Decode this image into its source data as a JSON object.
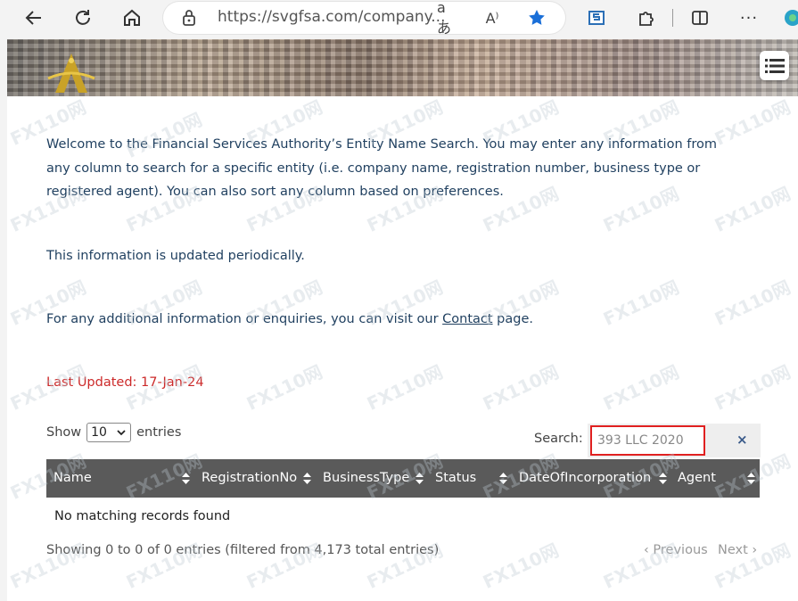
{
  "browser": {
    "url": "https://svgfsa.com/company...",
    "icons": [
      "back-icon",
      "refresh-icon",
      "home-icon",
      "lock-icon",
      "read-aloud-icon",
      "text-size-icon",
      "favorite-star-icon",
      "extension-icon",
      "puzzle-icon",
      "split-screen-icon",
      "more-icon"
    ],
    "read_aloud_glyph": "aあ",
    "immersive_glyph": "A⁾",
    "more_glyph": "···"
  },
  "page": {
    "intro": "Welcome to the Financial Services Authority’s Entity Name Search. You may enter any information from any column to search for a specific entity (i.e. company name, registration number, business type or registered agent). You can also sort any column based on preferences.",
    "periodic": "This information is updated periodically.",
    "enquiries_before": "For any additional information or enquiries, you can visit our ",
    "contact_link": "Contact",
    "enquiries_after": " page.",
    "last_updated": "Last Updated:  17-Jan-24"
  },
  "table": {
    "show_label": "Show",
    "entries_value": "10",
    "entries_label": "entries",
    "search_label": "Search:",
    "search_value": "393 LLC 2020",
    "clear_glyph": "×",
    "columns": [
      "Name",
      "RegistrationNo",
      "BusinessType",
      "Status",
      "DateOfIncorporation",
      "Agent"
    ],
    "empty_message": "No matching records found",
    "info": "Showing 0 to 0 of 0 entries (filtered from 4,173 total entries)",
    "previous": "Previous",
    "next": "Next"
  },
  "colors": {
    "accent_blue": "#1f3f5f",
    "header_bg": "#5a5a5a",
    "updated_red": "#cc2a2a",
    "search_highlight": "#e02020"
  },
  "watermark": "FX110网"
}
